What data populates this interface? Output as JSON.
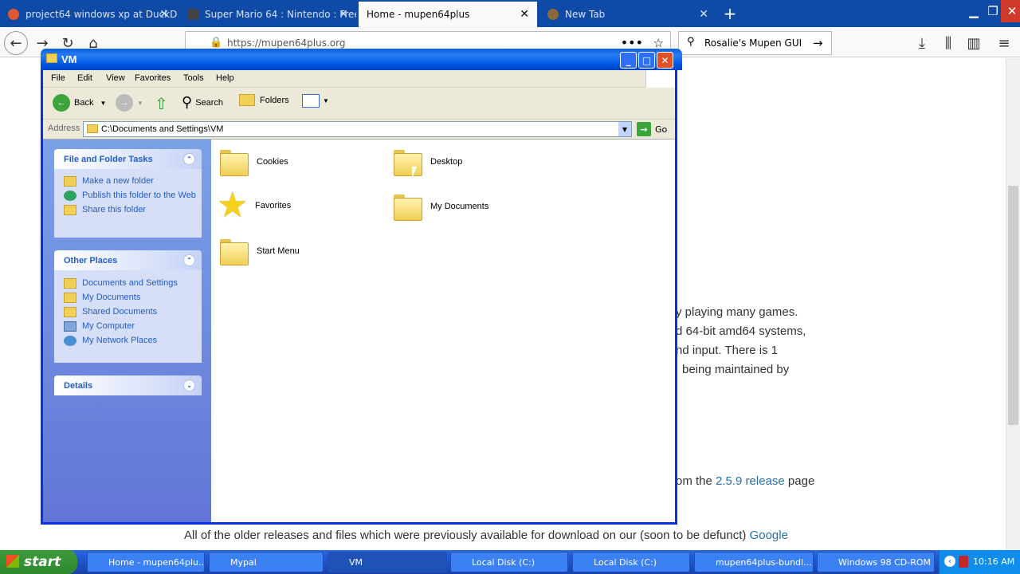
{
  "browser": {
    "tabs": [
      {
        "label": "project64 windows xp at DuckDu"
      },
      {
        "label": "Super Mario 64 : Nintendo : Free"
      },
      {
        "label": "Home - mupen64plus"
      },
      {
        "label": "New Tab"
      }
    ],
    "url": "https://mupen64plus.org",
    "search_text": "Rosalie's Mupen GUI"
  },
  "page": {
    "line1": "y playing many games.",
    "line2": "d 64-bit amd64 systems,",
    "line3": "nd input. There is 1",
    "line4": "being maintained by",
    "line5_pre": "om the ",
    "line5_link": "2.5.9 release",
    "line5_post": " page",
    "line6_pre": "All of the older releases and files which were previously available for download on our (soon to be defunct) ",
    "line6_link": "Google"
  },
  "explorer": {
    "title": "VM",
    "menu": [
      "File",
      "Edit",
      "View",
      "Favorites",
      "Tools",
      "Help"
    ],
    "toolbar": {
      "back": "Back",
      "search": "Search",
      "folders": "Folders"
    },
    "address_label": "Address",
    "address": "C:\\Documents and Settings\\VM",
    "go": "Go",
    "tasks_title": "File and Folder Tasks",
    "tasks": [
      "Make a new folder",
      "Publish this folder to the Web",
      "Share this folder"
    ],
    "places_title": "Other Places",
    "places": [
      "Documents and Settings",
      "My Documents",
      "Shared Documents",
      "My Computer",
      "My Network Places"
    ],
    "details_title": "Details",
    "items": [
      "Cookies",
      "Desktop",
      "Favorites",
      "My Documents",
      "Start Menu"
    ]
  },
  "taskbar": {
    "start": "start",
    "tasks": [
      "Home - mupen64plu...",
      "Mypal",
      "VM",
      "Local Disk (C:)",
      "Local Disk (C:)",
      "mupen64plus-bundl...",
      "Windows 98 CD-ROM"
    ],
    "clock": "10:16 AM"
  }
}
